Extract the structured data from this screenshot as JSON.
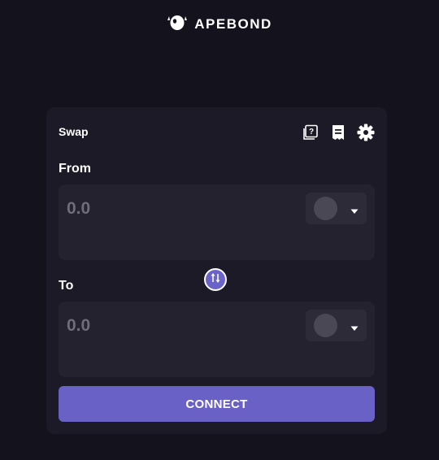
{
  "brand": {
    "name": "APEBOND",
    "logo_icon": "ape-head-logo-icon"
  },
  "swap": {
    "title": "Swap",
    "header_icons": [
      "help-book-icon",
      "receipt-icon",
      "gear-icon"
    ],
    "from": {
      "label": "From",
      "amount_placeholder": "0.0",
      "token_icon": "token-placeholder-icon",
      "caret_icon": "caret-down-icon"
    },
    "to": {
      "label": "To",
      "amount_placeholder": "0.0",
      "token_icon": "token-placeholder-icon",
      "caret_icon": "caret-down-icon"
    },
    "switch_icon": "swap-arrows-icon",
    "connect_label": "CONNECT"
  },
  "colors": {
    "background": "#14121d",
    "card": "#1c1a26",
    "panel": "#24222f",
    "accent": "#6a61c6"
  }
}
